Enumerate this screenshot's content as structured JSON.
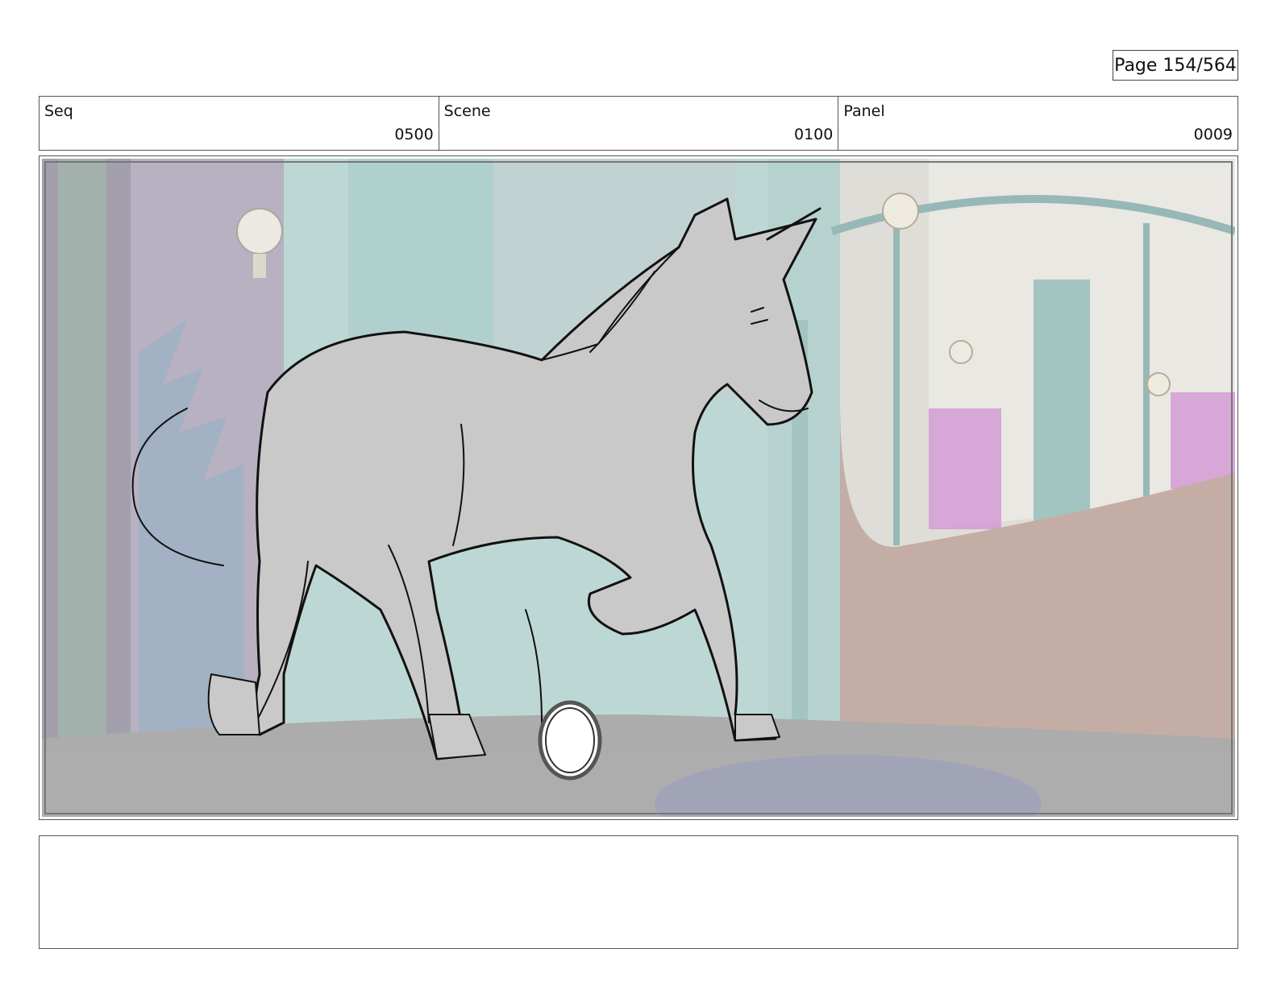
{
  "page": {
    "label": "Page 154/564"
  },
  "header": {
    "seq": {
      "label": "Seq",
      "value": "0500"
    },
    "scene": {
      "label": "Scene",
      "value": "0100"
    },
    "panel": {
      "label": "Panel",
      "value": "0009"
    }
  },
  "frame": {
    "subject": "unicorn-sketch",
    "colors": {
      "floor": "#9a9a9a",
      "wall_teal": "#a9c9c6",
      "wall_pink": "#b89c92",
      "accent_magenta": "#c77ac9",
      "sketch_fill": "#c9c9c9"
    }
  },
  "notes": {
    "text": ""
  }
}
